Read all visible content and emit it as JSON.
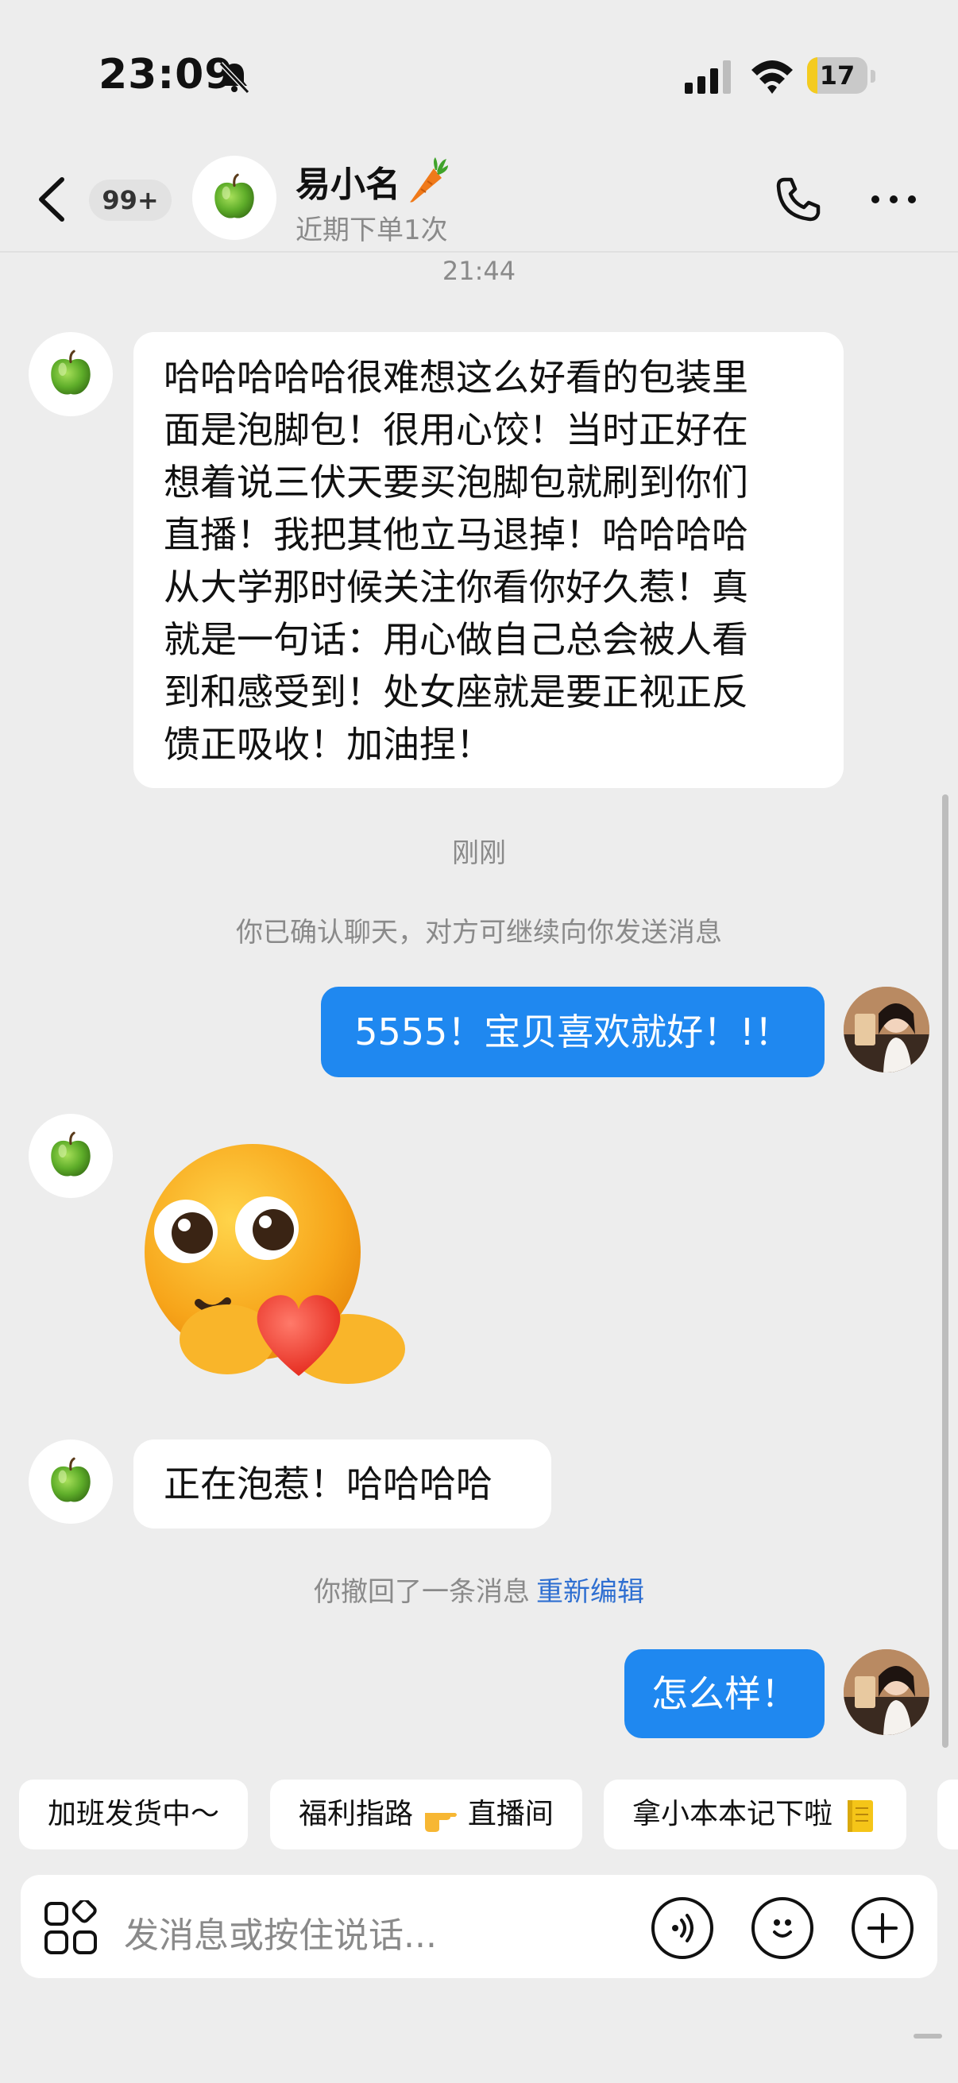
{
  "status_bar": {
    "time": "23:09",
    "battery": "17",
    "battery_level": 0.17
  },
  "header": {
    "unread_badge": "99+",
    "contact_name": "易小名",
    "contact_subtitle": "近期下单1次"
  },
  "messages": {
    "timestamp_1": "21:44",
    "incoming_1_lines": [
      "哈哈哈哈哈很难想这么好看的包装里",
      "面是泡脚包！很用心饺！当时正好在",
      "想着说三伏天要买泡脚包就刷到你们",
      "直播！我把其他立马退掉！哈哈哈哈",
      "从大学那时候关注你看你好久惹！真",
      "就是一句话：用心做自己总会被人看",
      "到和感受到！处女座就是要正视正反",
      "馈正吸收！加油捏！"
    ],
    "timestamp_2": "刚刚",
    "system_confirm": "你已确认聊天，对方可继续向你发送消息",
    "outgoing_1": "5555！宝贝喜欢就好！!！",
    "incoming_3": "正在泡惹！哈哈哈哈",
    "system_recall": "你撤回了一条消息",
    "system_recall_link": "重新编辑",
    "outgoing_2": "怎么样！"
  },
  "quick_replies": [
    {
      "label": "加班发货中～"
    },
    {
      "label_prefix": "福利指路",
      "label_suffix": "直播间"
    },
    {
      "label": "拿小本本记下啦"
    }
  ],
  "input": {
    "placeholder": "发消息或按住说话..."
  },
  "icons": [
    "bell-mute-icon",
    "signal-icon",
    "wifi-icon",
    "battery-icon",
    "back-icon",
    "apple-avatar-icon",
    "carrot-icon",
    "phone-icon",
    "more-icon",
    "heart-emoji-sticker",
    "user-avatar",
    "apps-grid-icon",
    "voice-icon",
    "emoji-icon",
    "plus-icon",
    "pointing-hand-emoji",
    "notebook-emoji"
  ],
  "colors": {
    "accent_blue": "#1f88f0",
    "link_blue": "#2f6fd1",
    "background": "#ededed"
  }
}
